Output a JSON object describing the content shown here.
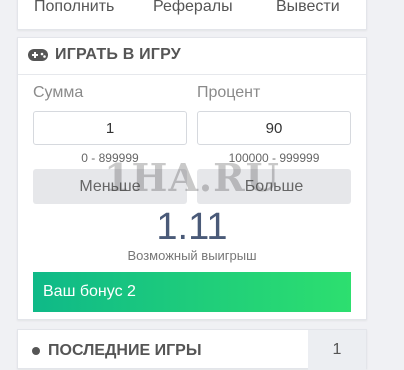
{
  "nav": {
    "items": [
      "Пополнить",
      "Рефералы",
      "Вывести"
    ]
  },
  "game": {
    "title": "ИГРАТЬ В ИГРУ",
    "icon": "gamepad-icon",
    "amount_label": "Сумма",
    "amount_value": "1",
    "amount_range": "0 - 899999",
    "percent_label": "Процент",
    "percent_value": "90",
    "percent_range": "100000 - 999999",
    "less_button": "Меньше",
    "more_button": "Больше",
    "payout": "1.11",
    "payout_label": "Возможный выигрыш",
    "bonus": "Ваш бонус 2",
    "watermark": "1HA.RU"
  },
  "recent": {
    "title": "ПОСЛЕДНИЕ ИГРЫ",
    "count": "1"
  },
  "colors": {
    "bonus_start": "#0fb988",
    "bonus_end": "#2ddf6f",
    "payout": "#4a5a78"
  }
}
